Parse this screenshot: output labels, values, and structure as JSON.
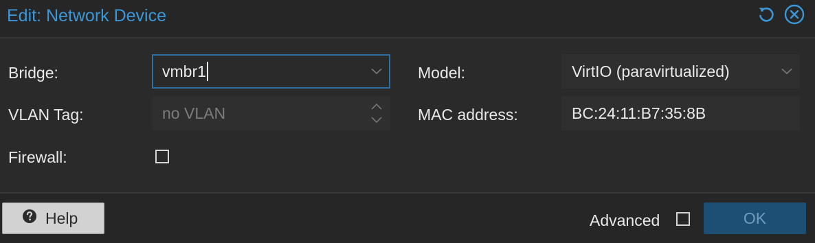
{
  "window": {
    "title": "Edit: Network Device"
  },
  "form": {
    "bridge": {
      "label": "Bridge:",
      "value": "vmbr1"
    },
    "vlan_tag": {
      "label": "VLAN Tag:",
      "placeholder": "no VLAN"
    },
    "firewall": {
      "label": "Firewall:",
      "checked": false
    },
    "model": {
      "label": "Model:",
      "value": "VirtIO (paravirtualized)"
    },
    "mac_address": {
      "label": "MAC address:",
      "value": "BC:24:11:B7:35:8B"
    }
  },
  "footer": {
    "help_label": "Help",
    "advanced_label": "Advanced",
    "advanced_checked": false,
    "ok_label": "OK"
  },
  "icons": {
    "reset": "reset-icon",
    "close": "close-icon",
    "help": "question-circle-icon",
    "dropdown": "chevron-down-icon",
    "spinner": "spinner-arrows-icon"
  },
  "colors": {
    "title": "#3c97d8",
    "ok_button": "#1d4f74",
    "focus_border": "#2f6fa3"
  }
}
